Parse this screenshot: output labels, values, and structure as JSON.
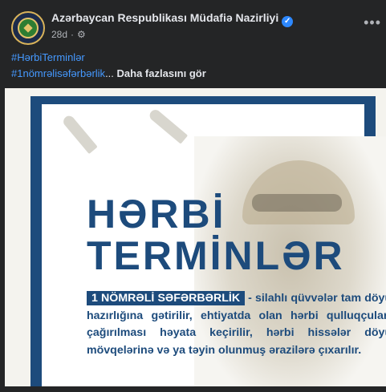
{
  "post": {
    "page_name": "Azərbaycan Respublikası Müdafiə Nazirliyi",
    "time": "28d",
    "separator": "·",
    "hashtag1": "#HərbiTerminlər",
    "hashtag2": "#1nömrəlisəfərbərlik",
    "ellipsis": "...",
    "see_more": "Daha fazlasını gör"
  },
  "icons": {
    "verified": "verified-badge-icon",
    "audience": "gear-icon",
    "more": "more-options-icon"
  },
  "poster": {
    "title_line1": "HƏRBİ",
    "title_line2": "TERMİNLƏR",
    "term": "1 NÖMRƏLİ SƏFƏRBƏRLİK",
    "definition": "- silahlı qüvvələr tam döyüş hazırlığına gətirilir, ehtiyatda olan hərbi qulluqçuların çağırılması həyata keçirilir, hərbi hissələr döyüş mövqelərinə və ya təyin olunmuş ərazilərə çıxarılır."
  },
  "colors": {
    "brand_blue": "#1d4b7c",
    "hashtag": "#4599ff",
    "background": "#242526"
  }
}
